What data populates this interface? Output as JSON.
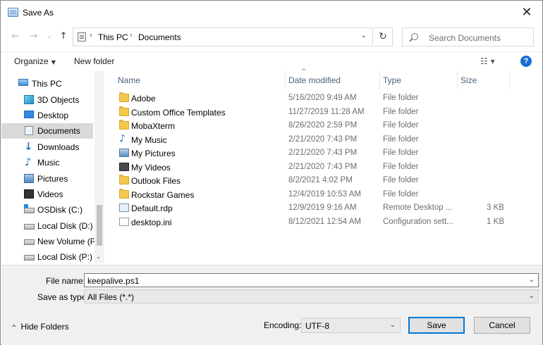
{
  "window": {
    "title": "Save As",
    "close_glyph": "✕"
  },
  "nav": {
    "back_glyph": "←",
    "forward_glyph": "→",
    "recent_glyph": "⌄",
    "up_glyph": "↑",
    "breadcrumb": [
      "This PC",
      "Documents"
    ],
    "sep_glyph": "›",
    "dropdown_glyph": "⌄",
    "refresh_glyph": "↻",
    "search_placeholder": "Search Documents"
  },
  "toolbar": {
    "organize_label": "Organize",
    "new_folder_label": "New folder",
    "view_glyph": "☷ ▾",
    "help_glyph": "?"
  },
  "sidebar": {
    "items": [
      {
        "label": "This PC",
        "icon": "computer-icon"
      },
      {
        "label": "3D Objects",
        "icon": "3d-objects-icon"
      },
      {
        "label": "Desktop",
        "icon": "desktop-icon"
      },
      {
        "label": "Documents",
        "icon": "documents-icon",
        "selected": true
      },
      {
        "label": "Downloads",
        "icon": "download-arrow-icon"
      },
      {
        "label": "Music",
        "icon": "music-note-icon"
      },
      {
        "label": "Pictures",
        "icon": "pictures-icon"
      },
      {
        "label": "Videos",
        "icon": "video-icon"
      },
      {
        "label": "OSDisk (C:)",
        "icon": "os-drive-icon"
      },
      {
        "label": "Local Disk (D:)",
        "icon": "drive-icon"
      },
      {
        "label": "New Volume (F:)",
        "icon": "drive-icon"
      },
      {
        "label": "Local Disk (P:)",
        "icon": "drive-icon"
      }
    ],
    "scroll_down_glyph": "⌄"
  },
  "filelist": {
    "sort_glyph": "^",
    "columns": {
      "name": "Name",
      "date": "Date modified",
      "type": "Type",
      "size": "Size"
    },
    "rows": [
      {
        "name": "Adobe",
        "date": "5/16/2020 9:49 AM",
        "type": "File folder",
        "size": "",
        "icon": "folder-icon"
      },
      {
        "name": "Custom Office Templates",
        "date": "11/27/2019 11:28 AM",
        "type": "File folder",
        "size": "",
        "icon": "folder-icon"
      },
      {
        "name": "MobaXterm",
        "date": "8/26/2020 2:59 PM",
        "type": "File folder",
        "size": "",
        "icon": "folder-icon"
      },
      {
        "name": "My Music",
        "date": "2/21/2020 7:43 PM",
        "type": "File folder",
        "size": "",
        "icon": "music-folder-icon"
      },
      {
        "name": "My Pictures",
        "date": "2/21/2020 7:43 PM",
        "type": "File folder",
        "size": "",
        "icon": "pictures-folder-icon"
      },
      {
        "name": "My Videos",
        "date": "2/21/2020 7:43 PM",
        "type": "File folder",
        "size": "",
        "icon": "videos-folder-icon"
      },
      {
        "name": "Outlook Files",
        "date": "8/2/2021 4:02 PM",
        "type": "File folder",
        "size": "",
        "icon": "folder-icon"
      },
      {
        "name": "Rockstar Games",
        "date": "12/4/2019 10:53 AM",
        "type": "File folder",
        "size": "",
        "icon": "folder-icon"
      },
      {
        "name": "Default.rdp",
        "date": "12/9/2019 9:16 AM",
        "type": "Remote Desktop ...",
        "size": "3 KB",
        "icon": "rdp-file-icon"
      },
      {
        "name": "desktop.ini",
        "date": "8/12/2021 12:54 AM",
        "type": "Configuration sett...",
        "size": "1 KB",
        "icon": "ini-file-icon"
      }
    ]
  },
  "save_panel": {
    "file_name_label": "File name:",
    "file_name_value": "keepalive.ps1",
    "save_type_label": "Save as type:",
    "save_type_value": "All Files  (*.*)",
    "dropdown_glyph": "⌄",
    "hide_folders_glyph": "^",
    "hide_folders_label": "Hide Folders",
    "encoding_label": "Encoding:",
    "encoding_value": "UTF-8",
    "save_label": "Save",
    "cancel_label": "Cancel"
  },
  "colors": {
    "accent": "#0078d7",
    "selected_bg": "#d9d9d9",
    "help_blue": "#1a6bd6"
  }
}
